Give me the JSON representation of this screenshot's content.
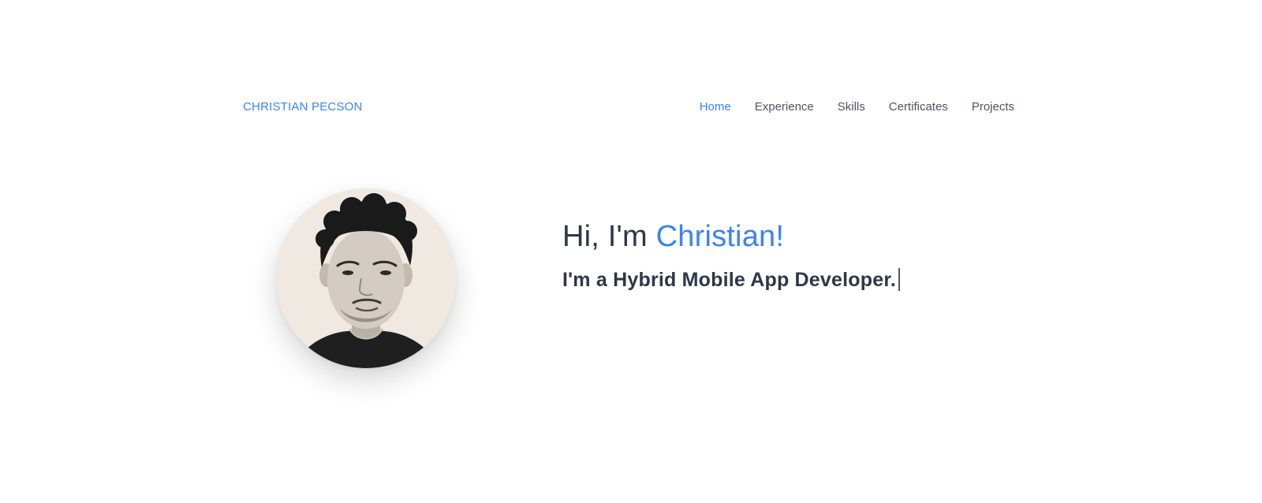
{
  "header": {
    "brand": "CHRISTIAN PECSON",
    "nav": [
      {
        "label": "Home",
        "active": true
      },
      {
        "label": "Experience",
        "active": false
      },
      {
        "label": "Skills",
        "active": false
      },
      {
        "label": "Certificates",
        "active": false
      },
      {
        "label": "Projects",
        "active": false
      }
    ]
  },
  "hero": {
    "greeting": "Hi, I'm ",
    "name": "Christian!",
    "tagline": "I'm a Hybrid Mobile App Developer."
  },
  "colors": {
    "accent": "#3b82f6",
    "text": "#2d3748",
    "nav_text": "#4b5563",
    "background": "#ffffff"
  },
  "icons": {
    "avatar": "profile-photo"
  }
}
